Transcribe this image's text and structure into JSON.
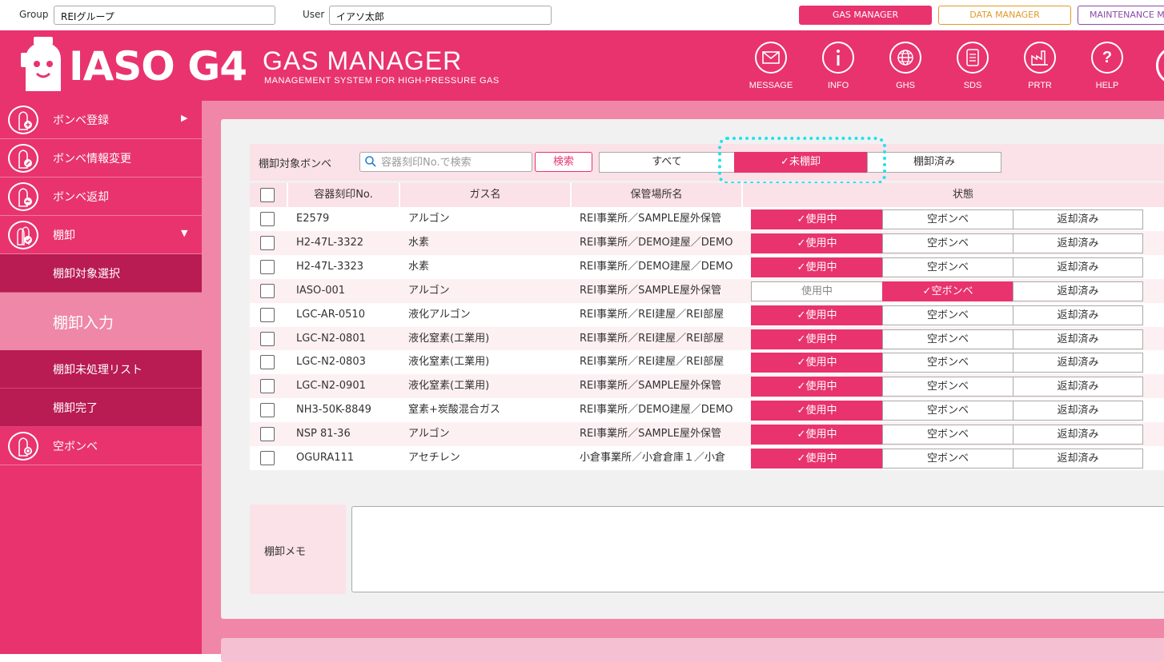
{
  "topbar": {
    "group_label": "Group",
    "group_value": "REIグループ",
    "user_label": "User",
    "user_value": "イアソ太郎",
    "managers": {
      "gas": "GAS MANAGER",
      "data": "DATA MANAGER",
      "maintenance": "MAINTENANCE MA"
    }
  },
  "header": {
    "logo": "IASO G4",
    "title": "GAS MANAGER",
    "subtitle": "MANAGEMENT SYSTEM FOR HIGH-PRESSURE GAS",
    "icons": [
      {
        "label": "MESSAGE",
        "icon": "mail-icon"
      },
      {
        "label": "INFO",
        "icon": "info-icon"
      },
      {
        "label": "GHS",
        "icon": "globe-icon"
      },
      {
        "label": "SDS",
        "icon": "document-icon"
      },
      {
        "label": "PRTR",
        "icon": "factory-icon"
      },
      {
        "label": "HELP",
        "icon": "help-icon"
      }
    ]
  },
  "sidebar": {
    "items": [
      {
        "label": "ボンベ登録"
      },
      {
        "label": "ボンベ情報変更"
      },
      {
        "label": "ボンベ返却"
      },
      {
        "label": "棚卸"
      },
      {
        "label": "空ボンベ"
      }
    ],
    "sub_items": [
      {
        "label": "棚卸対象選択"
      },
      {
        "label": "棚卸入力"
      },
      {
        "label": "棚卸未処理リスト"
      },
      {
        "label": "棚卸完了"
      }
    ]
  },
  "filter": {
    "label": "棚卸対象ボンベ",
    "search_placeholder": "容器刻印No.で検索",
    "search_button": "検索",
    "segments": [
      "すべて",
      "未棚卸",
      "棚卸済み"
    ],
    "selected": "未棚卸"
  },
  "table": {
    "columns": [
      "容器刻印No.",
      "ガス名",
      "保管場所名",
      "状態"
    ],
    "status_options": [
      "使用中",
      "空ボンベ",
      "返却済み"
    ],
    "rows": [
      {
        "id": "E2579",
        "gas": "アルゴン",
        "location": "REI事業所／SAMPLE屋外保管",
        "status": "使用中"
      },
      {
        "id": "H2-47L-3322",
        "gas": "水素",
        "location": "REI事業所／DEMO建屋／DEMO",
        "status": "使用中"
      },
      {
        "id": "H2-47L-3323",
        "gas": "水素",
        "location": "REI事業所／DEMO建屋／DEMO",
        "status": "使用中"
      },
      {
        "id": "IASO-001",
        "gas": "アルゴン",
        "location": "REI事業所／SAMPLE屋外保管",
        "status": "空ボンベ"
      },
      {
        "id": "LGC-AR-0510",
        "gas": "液化アルゴン",
        "location": "REI事業所／REI建屋／REI部屋",
        "status": "使用中"
      },
      {
        "id": "LGC-N2-0801",
        "gas": "液化窒素(工業用)",
        "location": "REI事業所／REI建屋／REI部屋",
        "status": "使用中"
      },
      {
        "id": "LGC-N2-0803",
        "gas": "液化窒素(工業用)",
        "location": "REI事業所／REI建屋／REI部屋",
        "status": "使用中"
      },
      {
        "id": "LGC-N2-0901",
        "gas": "液化窒素(工業用)",
        "location": "REI事業所／SAMPLE屋外保管",
        "status": "使用中"
      },
      {
        "id": "NH3-50K-8849",
        "gas": "窒素+炭酸混合ガス",
        "location": "REI事業所／DEMO建屋／DEMO",
        "status": "使用中"
      },
      {
        "id": "NSP 81-36",
        "gas": "アルゴン",
        "location": "REI事業所／SAMPLE屋外保管",
        "status": "使用中"
      },
      {
        "id": "OGURA111",
        "gas": "アセチレン",
        "location": "小倉事業所／小倉倉庫１／小倉",
        "status": "使用中"
      }
    ]
  },
  "memo": {
    "label": "棚卸メモ"
  },
  "colors": {
    "primary": "#e8336f",
    "sidebar_sub": "#b91b53",
    "sidebar_active": "#ef87a8",
    "highlight": "#1de3ef"
  }
}
